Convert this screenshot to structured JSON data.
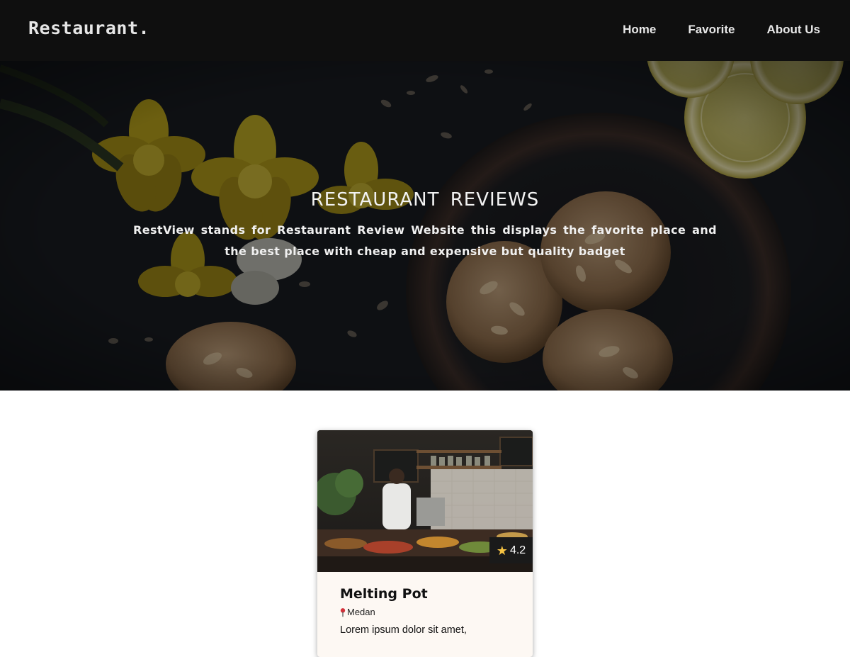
{
  "header": {
    "brand": "Restaurant.",
    "nav": [
      "Home",
      "Favorite",
      "About Us"
    ]
  },
  "hero": {
    "title": "RESTAURANT REVIEWS",
    "tagline": "RestView stands for Restaurant Review Website this displays the favorite place and the best place with cheap and expensive but quality badget"
  },
  "restaurants": [
    {
      "name": "Melting Pot",
      "city": "Medan",
      "rating": "4.2",
      "description": "Lorem ipsum dolor sit amet,"
    }
  ],
  "icons": {
    "rating": "star-icon",
    "city": "map-pin-icon"
  },
  "colors": {
    "header_bg": "#0f0f0f",
    "card_bg": "#fdf8f3",
    "star": "#f6c343",
    "pin": "#d3313a"
  }
}
